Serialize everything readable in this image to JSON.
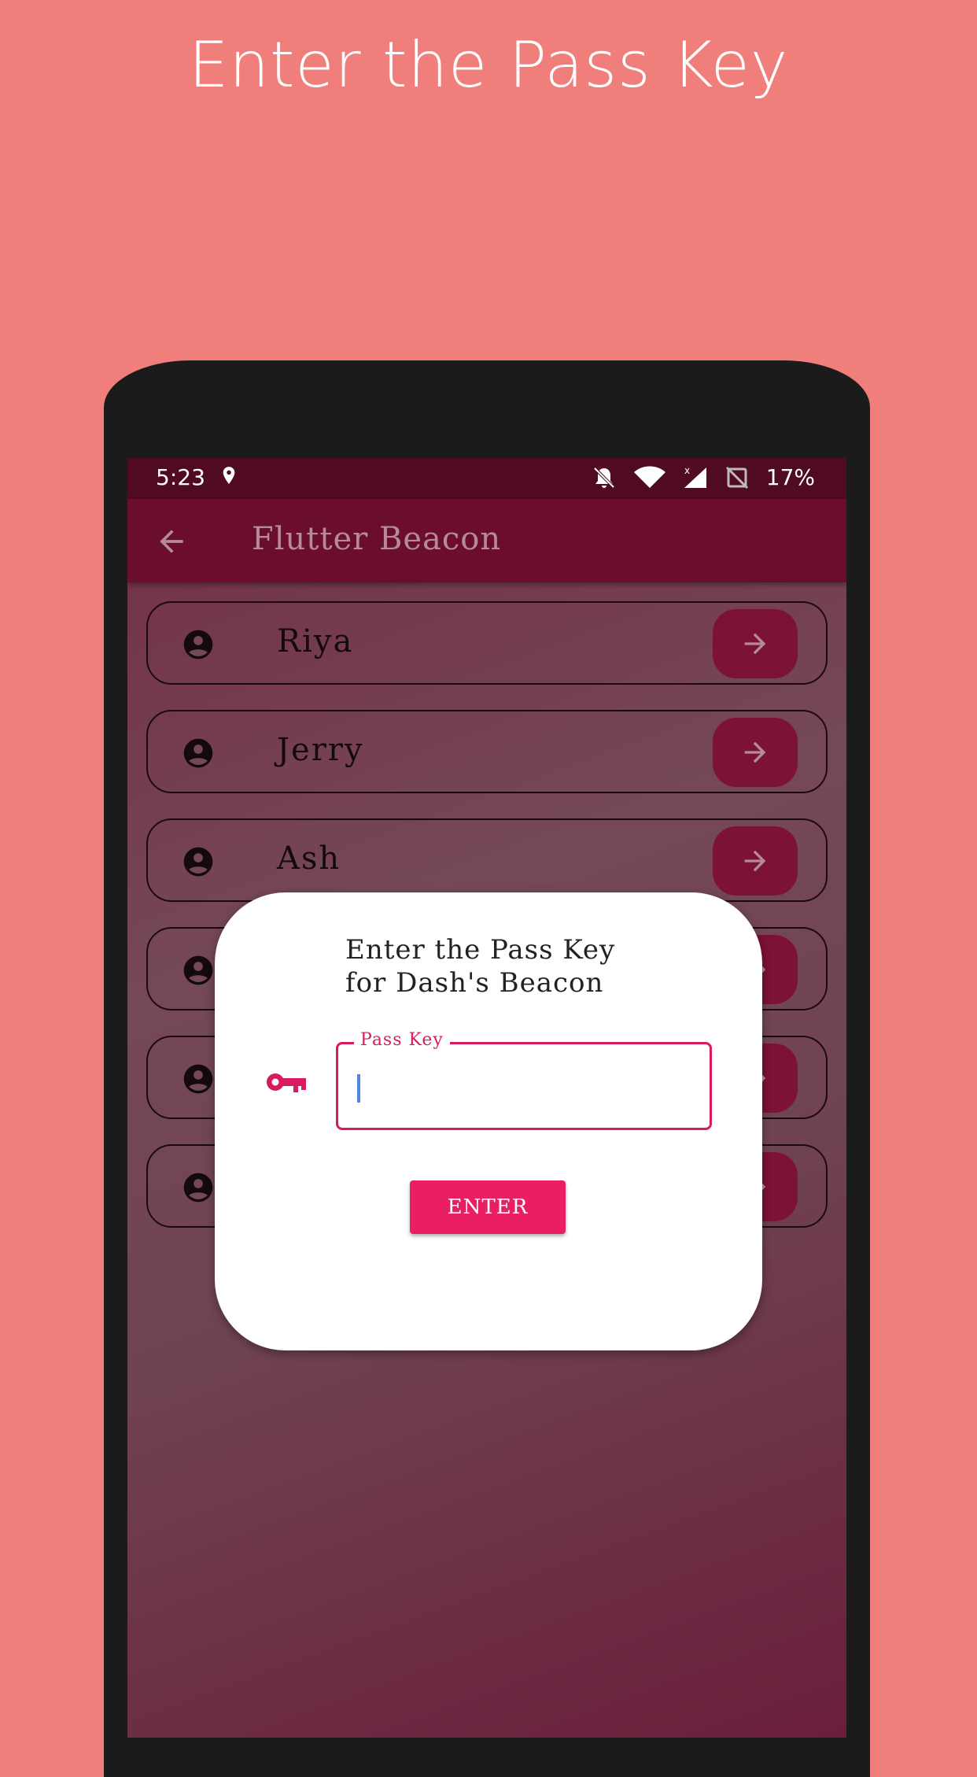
{
  "headline": "Enter the Pass Key",
  "status_bar": {
    "time": "5:23",
    "battery": "17%"
  },
  "app_bar": {
    "title": "Flutter Beacon"
  },
  "beacons": [
    {
      "name": "Riya"
    },
    {
      "name": "Jerry"
    },
    {
      "name": "Ash"
    },
    {
      "name": ""
    },
    {
      "name": ""
    },
    {
      "name": ""
    }
  ],
  "dialog": {
    "title_line1": "Enter the Pass Key",
    "title_line2": "for Dash's Beacon",
    "field_label": "Pass Key",
    "field_value": "",
    "button_label": "ENTER"
  },
  "colors": {
    "accent": "#e91e63",
    "appbar": "#6b0e2d",
    "statusbar": "#500a22",
    "background": "#f07f7c"
  },
  "icons": [
    "location-icon",
    "bell-off-icon",
    "wifi-icon",
    "signal-icon",
    "battery-icon",
    "back-arrow-icon",
    "account-circle-icon",
    "arrow-forward-icon",
    "key-icon"
  ]
}
